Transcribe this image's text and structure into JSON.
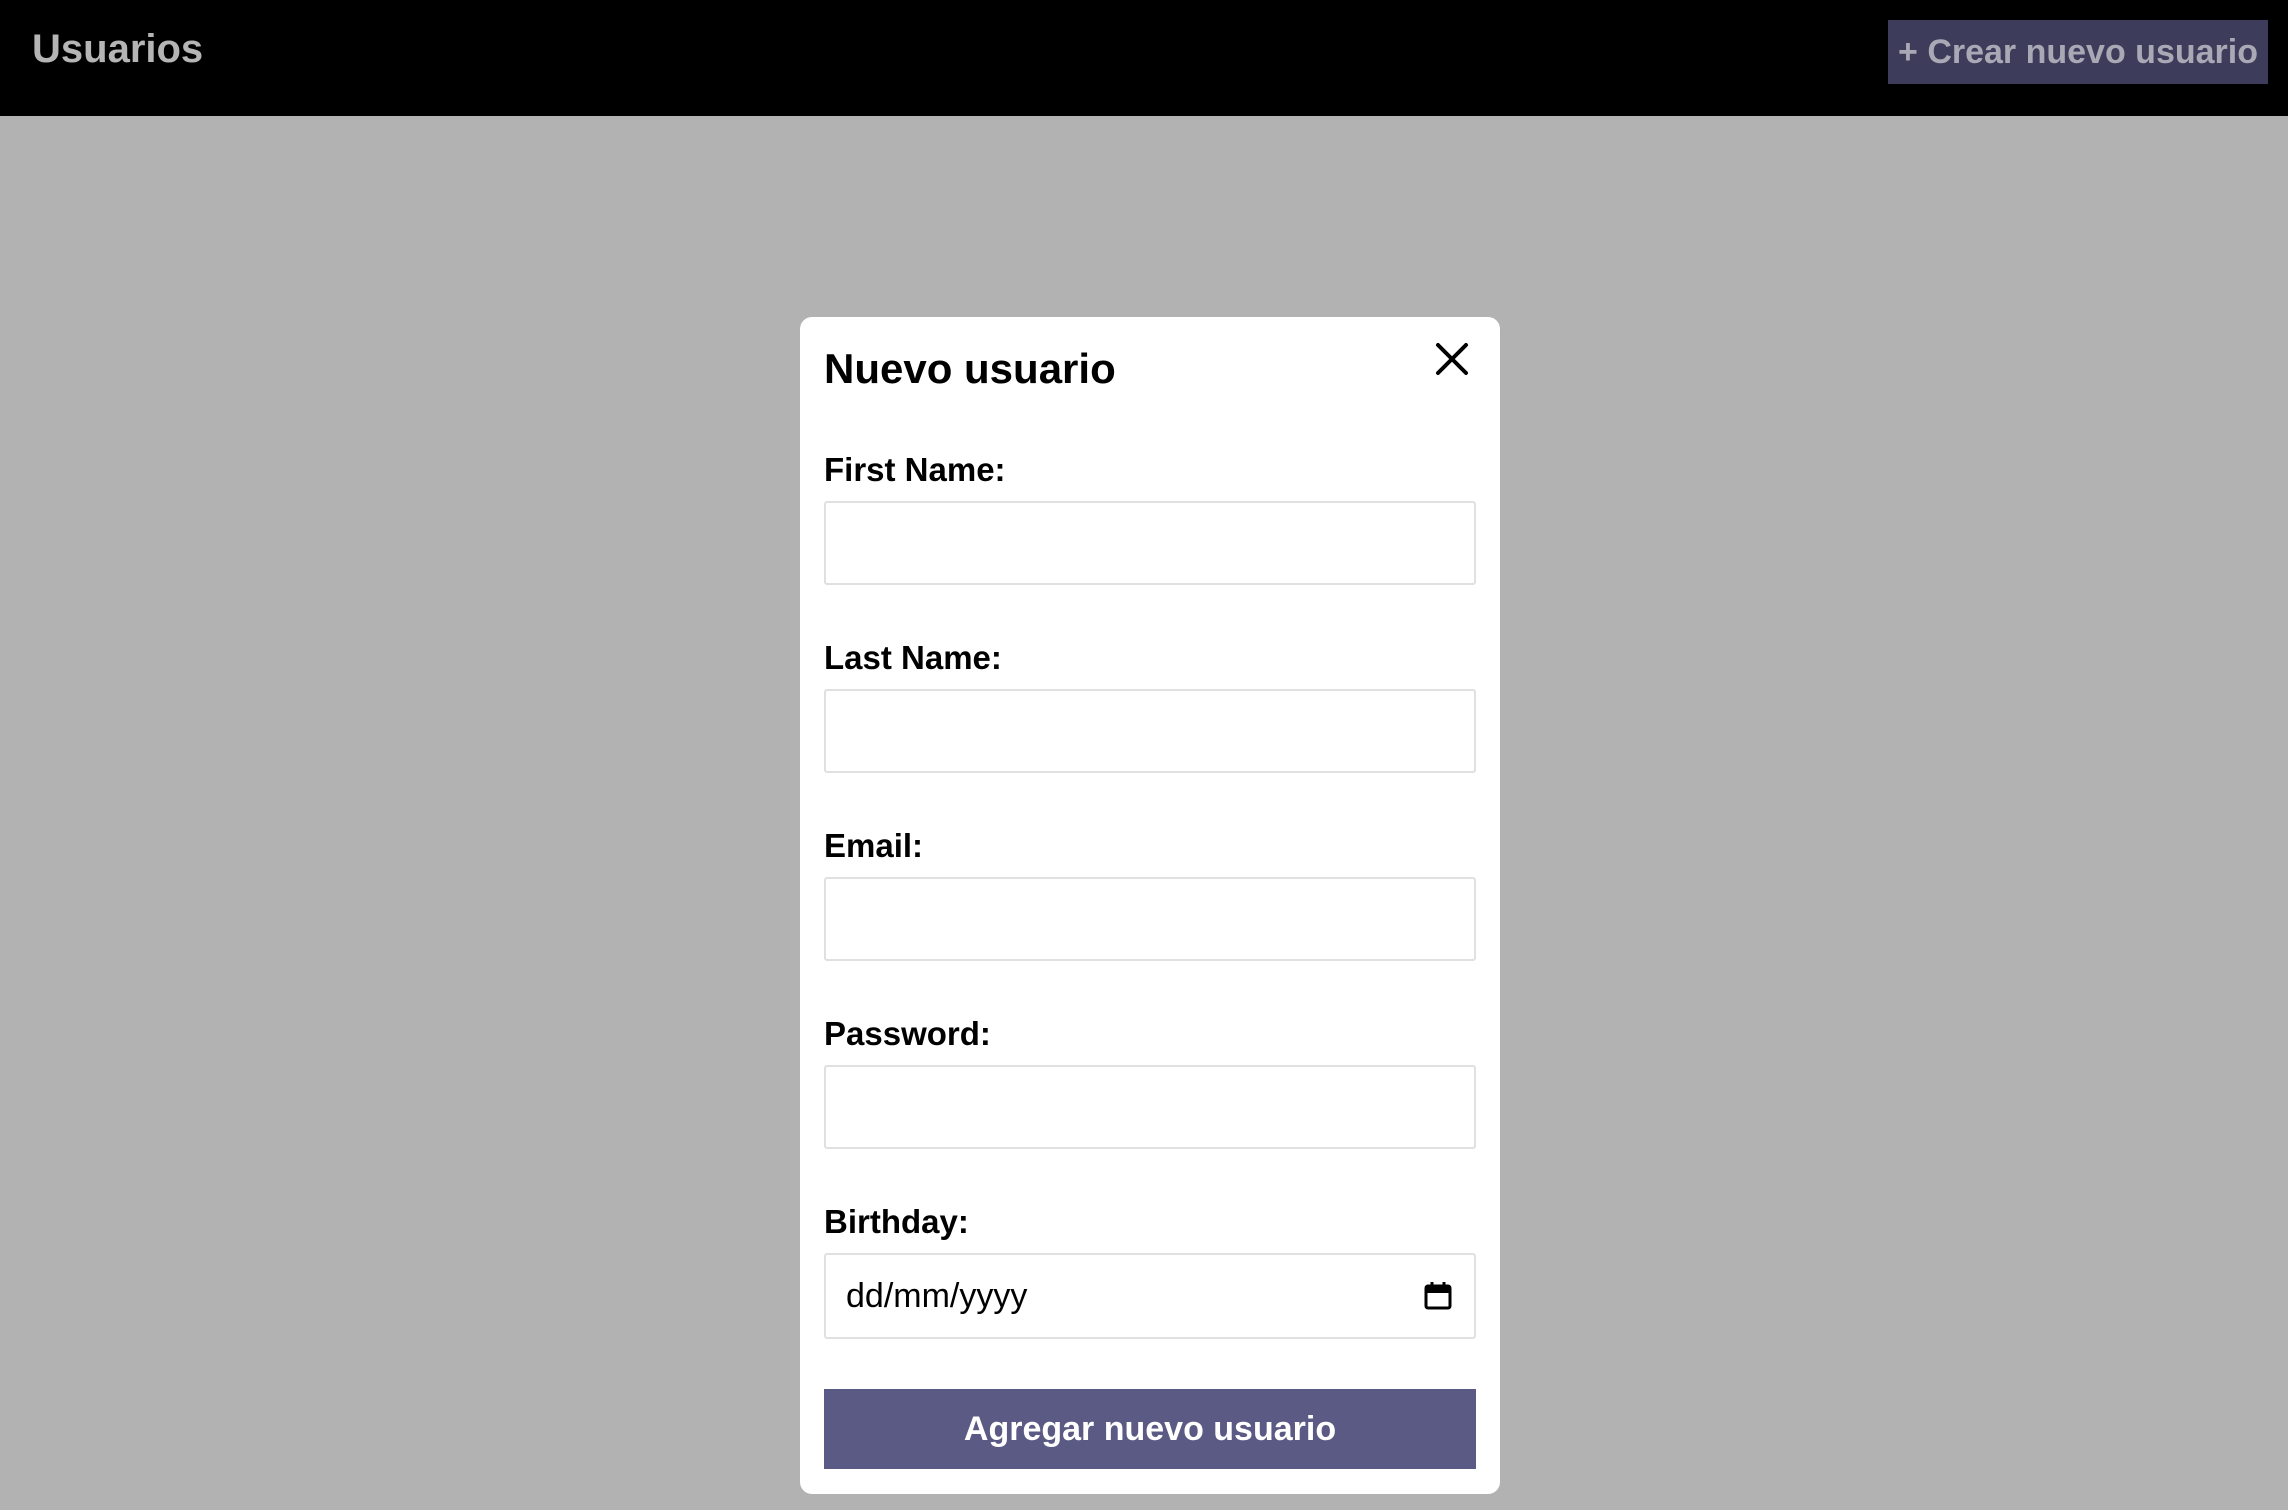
{
  "header": {
    "title": "Usuarios",
    "create_button_label": "+ Crear nuevo usuario"
  },
  "modal": {
    "title": "Nuevo usuario",
    "close_icon": "close-icon",
    "fields": {
      "first_name": {
        "label": "First Name:",
        "value": ""
      },
      "last_name": {
        "label": "Last Name:",
        "value": ""
      },
      "email": {
        "label": "Email:",
        "value": ""
      },
      "password": {
        "label": "Password:",
        "value": ""
      },
      "birthday": {
        "label": "Birthday:",
        "placeholder": "dd/mm/yyyy",
        "icon": "calendar-icon"
      }
    },
    "submit_label": "Agregar nuevo usuario"
  },
  "colors": {
    "header_bg": "#000000",
    "overlay_bg": "#b2b2b2",
    "header_button_bg": "#3d3c5a",
    "submit_button_bg": "#5a5a85"
  }
}
